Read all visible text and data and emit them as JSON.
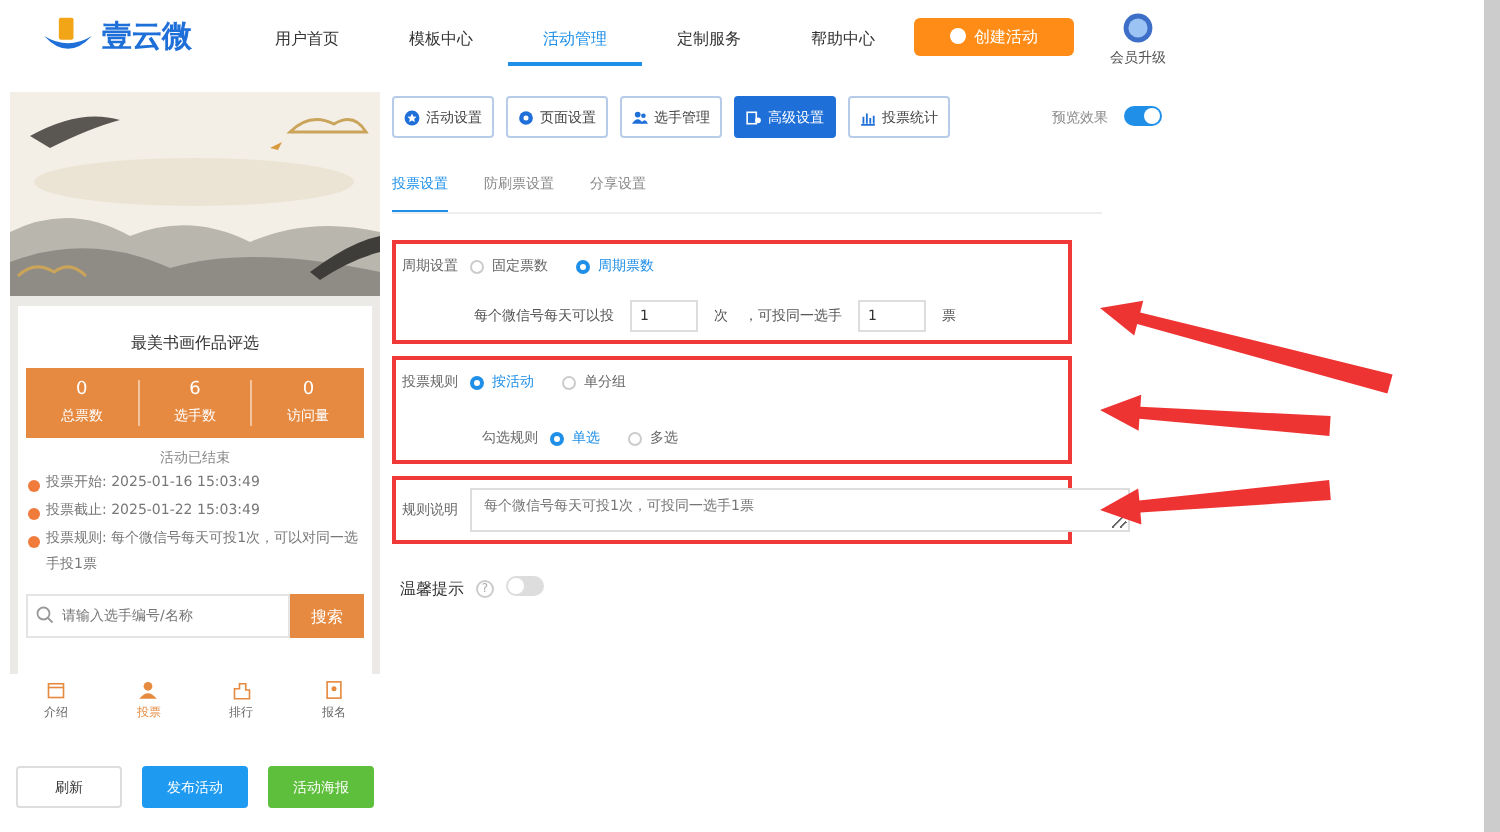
{
  "header": {
    "brand": "壹云微",
    "nav": [
      {
        "label": "用户首页",
        "selected": false
      },
      {
        "label": "模板中心",
        "selected": false
      },
      {
        "label": "活动管理",
        "selected": true
      },
      {
        "label": "定制服务",
        "selected": false
      },
      {
        "label": "帮助中心",
        "selected": false
      }
    ],
    "create_button": "创建活动",
    "vip_label": "会员升级"
  },
  "preview": {
    "title": "最美书画作品评选",
    "stats": [
      {
        "value": "0",
        "label": "总票数"
      },
      {
        "value": "6",
        "label": "选手数"
      },
      {
        "value": "0",
        "label": "访问量"
      }
    ],
    "status": "活动已结束",
    "info": [
      {
        "label": "投票开始:",
        "text": "2025-01-16 15:03:49"
      },
      {
        "label": "投票截止:",
        "text": "2025-01-22 15:03:49"
      },
      {
        "label": "投票规则:",
        "text": "每个微信号每天可投1次，可以对同一选手投1票"
      }
    ],
    "search": {
      "placeholder": "请输入选手编号/名称",
      "button": "搜索"
    },
    "bottom_nav": [
      {
        "label": "介绍",
        "selected": false
      },
      {
        "label": "投票",
        "selected": true
      },
      {
        "label": "排行",
        "selected": false
      },
      {
        "label": "报名",
        "selected": false
      }
    ],
    "actions": [
      {
        "label": "刷新",
        "kind": "plain"
      },
      {
        "label": "发布活动",
        "kind": "primary"
      },
      {
        "label": "活动海报",
        "kind": "success"
      }
    ]
  },
  "toolbar": [
    {
      "label": "活动设置",
      "selected": false
    },
    {
      "label": "页面设置",
      "selected": false
    },
    {
      "label": "选手管理",
      "selected": false
    },
    {
      "label": "高级设置",
      "selected": true
    },
    {
      "label": "投票统计",
      "selected": false
    }
  ],
  "preview_toggle": {
    "label": "预览效果",
    "on": true
  },
  "tabs": [
    {
      "label": "投票设置",
      "selected": true
    },
    {
      "label": "防刷票设置",
      "selected": false
    },
    {
      "label": "分享设置",
      "selected": false
    }
  ],
  "sections": [
    {
      "highlighted": true,
      "rows": [
        {
          "kind": "radio",
          "label": "周期设置",
          "options": [
            {
              "label": "固定票数",
              "selected": false
            },
            {
              "label": "周期票数",
              "selected": true
            }
          ]
        },
        {
          "kind": "counter",
          "segments": [
            {
              "kind": "text",
              "text": "每个微信号每天可以投"
            },
            {
              "kind": "field",
              "value": "1"
            },
            {
              "kind": "text",
              "text": "次"
            },
            {
              "kind": "text",
              "text": "，可投同一选手"
            },
            {
              "kind": "field",
              "value": "1"
            },
            {
              "kind": "text",
              "text": "票"
            }
          ]
        }
      ]
    },
    {
      "highlighted": true,
      "rows": [
        {
          "kind": "radio",
          "label": "投票规则",
          "options": [
            {
              "label": "按活动",
              "selected": true
            },
            {
              "label": "单分组",
              "selected": false
            }
          ]
        },
        {
          "kind": "radio",
          "label": "勾选规则",
          "options": [
            {
              "label": "单选",
              "selected": true
            },
            {
              "label": "多选",
              "selected": false
            }
          ]
        }
      ]
    },
    {
      "highlighted": true,
      "rows": [
        {
          "kind": "textarea",
          "label": "规则说明",
          "placeholder": "每个微信号每天可投1次，可投同一选手1票"
        }
      ]
    }
  ],
  "tip": {
    "label": "温馨提示",
    "help": "?",
    "on": false
  }
}
